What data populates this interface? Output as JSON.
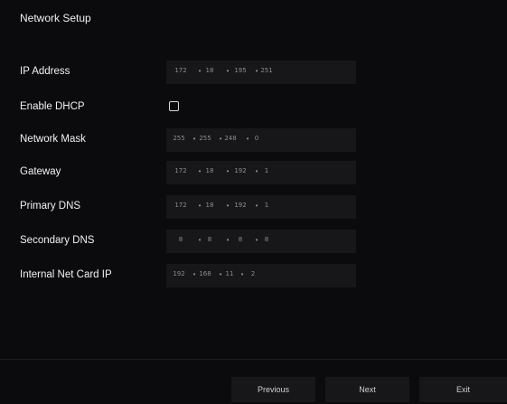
{
  "title": "Network Setup",
  "fields": [
    {
      "label": "IP Address",
      "type": "ip",
      "octets": [
        "172",
        "18",
        "195",
        "251"
      ]
    },
    {
      "label": "Enable DHCP",
      "type": "checkbox",
      "checked": false
    },
    {
      "label": "Network Mask",
      "type": "ip",
      "octets": [
        "255",
        "255",
        "248",
        "0"
      ]
    },
    {
      "label": "Gateway",
      "type": "ip",
      "octets": [
        "172",
        "18",
        "192",
        "1"
      ]
    },
    {
      "label": "Primary DNS",
      "type": "ip",
      "octets": [
        "172",
        "18",
        "192",
        "1"
      ]
    },
    {
      "label": "Secondary DNS",
      "type": "ip",
      "octets": [
        "8",
        "8",
        "8",
        "8"
      ]
    },
    {
      "label": "Internal Net Card IP",
      "type": "ip",
      "octets": [
        "192",
        "168",
        "11",
        "2"
      ]
    }
  ],
  "buttons": {
    "previous": "Previous",
    "next": "Next",
    "exit": "Exit"
  }
}
